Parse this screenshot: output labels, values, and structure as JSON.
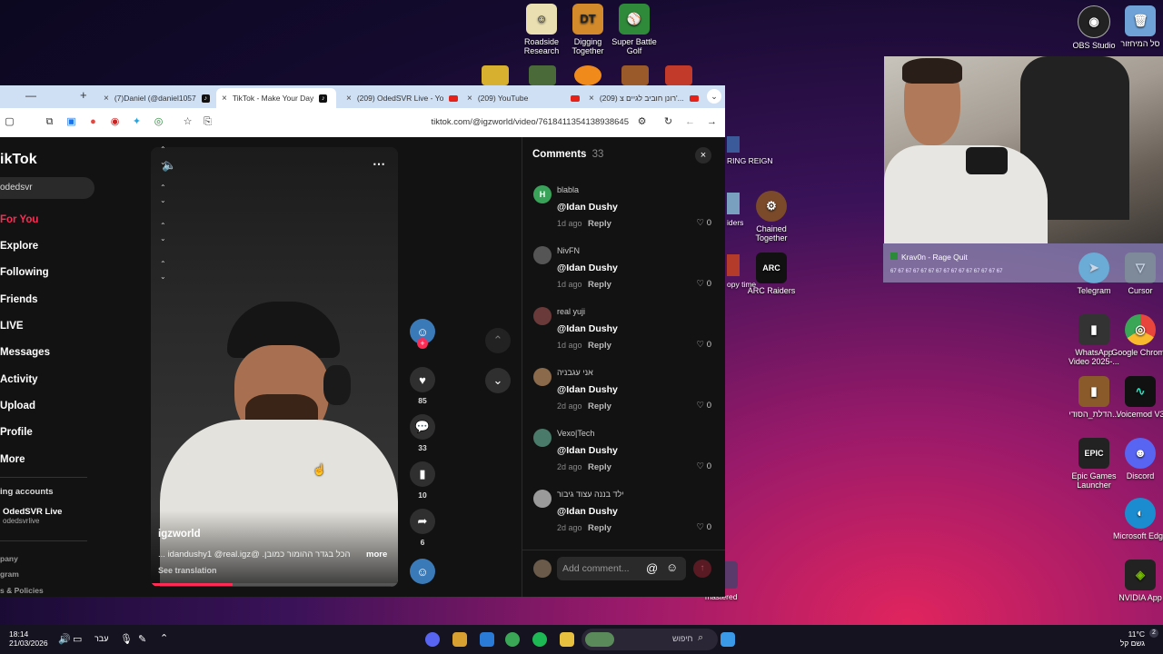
{
  "desktop": {
    "top_icons": [
      {
        "label": "Roadside Research",
        "glyph": "☺",
        "color": "#e9dfb0"
      },
      {
        "label": "Digging Together",
        "glyph": "DT",
        "color": "#d28a2a"
      },
      {
        "label": "Super Battle Golf",
        "glyph": "⚾",
        "color": "#2f8a3a"
      }
    ],
    "right_icons": [
      {
        "label": "OBS Studio",
        "glyph": "◉",
        "color": "#222"
      },
      {
        "label": "סל המיחזור",
        "glyph": "🗑",
        "color": "#6fa3d8"
      },
      {
        "label": "Telegram",
        "glyph": "➤",
        "color": "#2aa3dd"
      },
      {
        "label": "Cursor",
        "glyph": "▽",
        "color": "#555"
      },
      {
        "label": "WhatsApp Video 2025-...",
        "glyph": "▮",
        "color": "#333"
      },
      {
        "label": "Google Chrome",
        "glyph": "◎",
        "color": "#e8453c"
      },
      {
        "label": "הדלת_הסודי...",
        "glyph": "▮",
        "color": "#8a5a2a"
      },
      {
        "label": "Voicemod V3",
        "glyph": "∿",
        "color": "#111"
      },
      {
        "label": "Epic Games Launcher",
        "glyph": "EPIC",
        "color": "#222"
      },
      {
        "label": "Discord",
        "glyph": "☻",
        "color": "#5865f2"
      },
      {
        "label": "Microsoft Edge",
        "glyph": "◐",
        "color": "#1b8ccf"
      },
      {
        "label": "NVIDIA App",
        "glyph": "◈",
        "color": "#76b900"
      }
    ],
    "mid_icons": [
      {
        "label": "Chained Together",
        "glyph": "⚙",
        "color": "#7a4a2a"
      },
      {
        "label": "ARC Raiders",
        "glyph": "ARC",
        "color": "#111"
      }
    ],
    "partial_labels": [
      "RING REIGN",
      "iders",
      "opy time",
      "mastered"
    ]
  },
  "browser": {
    "tabs": [
      {
        "title": "(7)Daniel (@daniel1057",
        "icon": "tiktok"
      },
      {
        "title": "TikTok - Make Your Day",
        "icon": "tiktok",
        "active": true
      },
      {
        "title": "(209) OdedSVR Live - Yo",
        "icon": "youtube"
      },
      {
        "title": "(209) YouTube",
        "icon": "youtube"
      },
      {
        "title": "(209) רונן חוביב לגיים צ'...",
        "icon": "youtube"
      }
    ],
    "url": "tiktok.com/@igzworld/video/7618411354138938645"
  },
  "tiktok": {
    "logo": "ikTok",
    "search_value": "odedsvr",
    "nav": [
      "For You",
      "Explore",
      "Following",
      "Friends",
      "LIVE",
      "Messages",
      "Activity",
      "Upload",
      "Profile",
      "More"
    ],
    "following_header": "ing accounts",
    "following_account": {
      "name": "OdedSVR Live",
      "handle": "odedsvrlive"
    },
    "footer_links": [
      "pany",
      "gram",
      "s & Policies"
    ],
    "video": {
      "author": "igzworld",
      "caption": "הכל בגדר ההומור כמובן. @idandushy1 @real.igz ...",
      "more": "more",
      "see_translation": "See translation",
      "progress_percent": 33
    },
    "actions": {
      "likes": "85",
      "comments": "33",
      "saves": "10",
      "shares": "6"
    },
    "comments_panel": {
      "title": "Comments",
      "count": "33",
      "items": [
        {
          "user": "blabla",
          "text": "@Idan Dushy",
          "time": "1d ago",
          "reply": "Reply",
          "likes": "0",
          "avatar_color": "#3aa35a",
          "avatar_letter": "H"
        },
        {
          "user": "NivFN",
          "text": "@Idan Dushy",
          "time": "1d ago",
          "reply": "Reply",
          "likes": "0",
          "avatar_color": "#555",
          "avatar_letter": ""
        },
        {
          "user": "real yuji",
          "text": "@Idan Dushy",
          "time": "1d ago",
          "reply": "Reply",
          "likes": "0",
          "avatar_color": "#6a3a3a",
          "avatar_letter": ""
        },
        {
          "user": "אני עגבניה",
          "text": "@Idan Dushy",
          "time": "2d ago",
          "reply": "Reply",
          "likes": "0",
          "avatar_color": "#8a6a4a",
          "avatar_letter": ""
        },
        {
          "user": "Vexo|Tech",
          "text": "@Idan Dushy",
          "time": "2d ago",
          "reply": "Reply",
          "likes": "0",
          "avatar_color": "#4a7a6a",
          "avatar_letter": ""
        },
        {
          "user": "ילד בננה עצוד גיבור",
          "text": "@Idan Dushy",
          "time": "2d ago",
          "reply": "Reply",
          "likes": "0",
          "avatar_color": "#9a9a9a",
          "avatar_letter": ""
        }
      ],
      "input_placeholder": "Add comment..."
    }
  },
  "overlay": {
    "rage_title": "Krav0n - Rage Quit",
    "rage_text": "67 67 67 67 67 67 67 67 67 67 67 67 67 67 67"
  },
  "taskbar": {
    "time": "18:14",
    "date": "21/03/2026",
    "lang": "עבר",
    "search": "חיפוש",
    "weather_temp": "11°C",
    "weather_text": "גשם קל"
  }
}
